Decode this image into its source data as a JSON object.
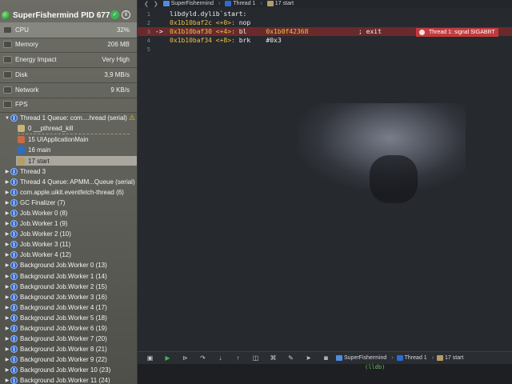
{
  "process": {
    "name": "SuperFishermind",
    "pid_label": "PID 677"
  },
  "gauges": [
    {
      "label": "CPU",
      "value": "32%"
    },
    {
      "label": "Memory",
      "value": "206 MB"
    },
    {
      "label": "Energy Impact",
      "value": "Very High"
    },
    {
      "label": "Disk",
      "value": "3,9 MB/s"
    },
    {
      "label": "Network",
      "value": "9 KB/s"
    },
    {
      "label": "FPS",
      "value": ""
    }
  ],
  "threads": {
    "thread1": "Thread 1 Queue: com....hread (serial)",
    "frames": [
      {
        "label": "0 __pthread_kill"
      },
      {
        "label": "15 UIApplicationMain"
      },
      {
        "label": "16 main"
      },
      {
        "label": "17 start"
      }
    ],
    "others": [
      "Thread 3",
      "Thread 4 Queue: APMM...Queue (serial)",
      "com.apple.uikit.eventfetch-thread (6)",
      "GC Finalizer (7)",
      "Job.Worker 0 (8)",
      "Job.Worker 1 (9)",
      "Job.Worker 2 (10)",
      "Job.Worker 3 (11)",
      "Job.Worker 4 (12)",
      "Background Job.Worker 0 (13)",
      "Background Job.Worker 1 (14)",
      "Background Job.Worker 2 (15)",
      "Background Job.Worker 3 (16)",
      "Background Job.Worker 4 (17)",
      "Background Job.Worker 5 (18)",
      "Background Job.Worker 6 (19)",
      "Background Job.Worker 7 (20)",
      "Background Job.Worker 8 (21)",
      "Background Job.Worker 9 (22)",
      "Background Job.Worker 10 (23)",
      "Background Job.Worker 11 (24)"
    ]
  },
  "jumpbar": {
    "app": "SuperFishermind",
    "thread": "Thread 1",
    "frame": "17 start"
  },
  "code": {
    "lines": [
      {
        "n": "1",
        "arrow": "",
        "text": "libdyld.dylib`start:",
        "addr": "",
        "op": "",
        "arg": "",
        "comment": ""
      },
      {
        "n": "2",
        "arrow": "",
        "text": "",
        "addr": "0x1b10baf2c <+0>:",
        "op": " nop",
        "arg": "",
        "comment": ""
      },
      {
        "n": "3",
        "arrow": "->",
        "text": "",
        "addr": "0x1b10baf30 <+4>:",
        "op": " bl",
        "arg": "     0x1b0f42368",
        "comment": "             ; exit"
      },
      {
        "n": "4",
        "arrow": "",
        "text": "",
        "addr": "0x1b10baf34 <+8>:",
        "op": " brk",
        "arg": "    #0x3",
        "comment": ""
      },
      {
        "n": "5",
        "arrow": "",
        "text": "",
        "addr": "",
        "op": "",
        "arg": "",
        "comment": ""
      }
    ],
    "error_badge": "Thread 1: signal SIGABRT"
  },
  "debugbar": {
    "app": "SuperFishermind",
    "thread": "Thread 1",
    "frame": "17 start"
  },
  "console": {
    "prompt": "(lldb)"
  },
  "colors": {
    "accent_green": "#3bb552",
    "error_red": "#c23a3d",
    "address_yellow": "#e8c14a"
  }
}
